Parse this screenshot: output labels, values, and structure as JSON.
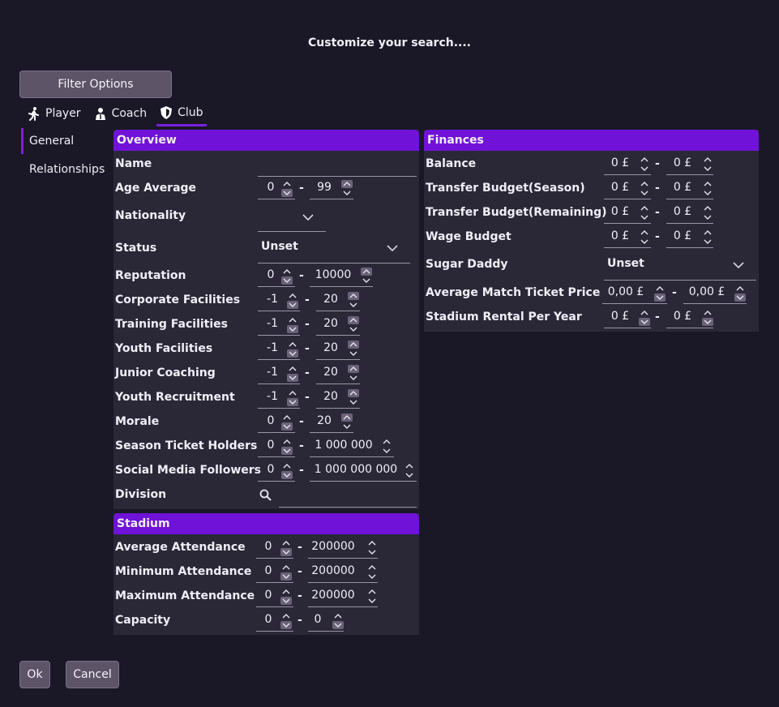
{
  "dialog": {
    "title": "Customize your search...."
  },
  "filter_button": "Filter Options",
  "tabs": [
    {
      "label": "Player"
    },
    {
      "label": "Coach"
    },
    {
      "label": "Club"
    }
  ],
  "sidebar": [
    {
      "label": "General"
    },
    {
      "label": "Relationships"
    }
  ],
  "overview": {
    "header": "Overview",
    "name_label": "Name",
    "name_value": "",
    "age_label": "Age Average",
    "age_from": "0",
    "age_to": "99",
    "nationality_label": "Nationality",
    "status_label": "Status",
    "status_value": "Unset",
    "reputation_label": "Reputation",
    "reputation_from": "0",
    "reputation_to": "10000",
    "facilities": [
      {
        "label": "Corporate Facilities",
        "from": "-1",
        "to": "20"
      },
      {
        "label": "Training Facilities",
        "from": "-1",
        "to": "20"
      },
      {
        "label": "Youth Facilities",
        "from": "-1",
        "to": "20"
      },
      {
        "label": "Junior Coaching",
        "from": "-1",
        "to": "20"
      },
      {
        "label": "Youth Recruitment",
        "from": "-1",
        "to": "20"
      }
    ],
    "morale_label": "Morale",
    "morale_from": "0",
    "morale_to": "20",
    "season_label": "Season Ticket Holders",
    "season_from": "0",
    "season_to": "1 000 000",
    "social_label": "Social Media Followers",
    "social_from": "0",
    "social_to": "1 000 000 000",
    "division_label": "Division"
  },
  "stadium": {
    "header": "Stadium",
    "rows": [
      {
        "label": "Average Attendance",
        "from": "0",
        "to": "200000"
      },
      {
        "label": "Minimum Attendance",
        "from": "0",
        "to": "200000"
      },
      {
        "label": "Maximum Attendance",
        "from": "0",
        "to": "200000"
      },
      {
        "label": "Capacity",
        "from": "0",
        "to": "0"
      }
    ]
  },
  "finances": {
    "header": "Finances",
    "rows": [
      {
        "label": "Balance",
        "from": "0 £",
        "to": "0 £"
      },
      {
        "label": "Transfer Budget(Season)",
        "from": "0 £",
        "to": "0 £"
      },
      {
        "label": "Transfer Budget(Remaining)",
        "from": "0 £",
        "to": "0 £"
      },
      {
        "label": "Wage Budget",
        "from": "0 £",
        "to": "0 £"
      }
    ],
    "sugar_label": "Sugar Daddy",
    "sugar_value": "Unset",
    "ticket_label": "Average Match Ticket Price",
    "ticket_from": "0,00 £",
    "ticket_to": "0,00 £",
    "rental_label": "Stadium Rental Per Year",
    "rental_from": "0 £",
    "rental_to": "0 £"
  },
  "footer": {
    "ok": "Ok",
    "cancel": "Cancel"
  },
  "dash": "-",
  "colors": {
    "accent": "#7012d8",
    "panel": "#2a2837",
    "background": "#1a1826"
  }
}
